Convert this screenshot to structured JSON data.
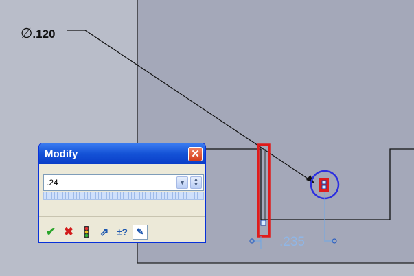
{
  "drawing": {
    "diameter_symbol": "∅",
    "diameter_value": ".120",
    "linear_dimension": ".235",
    "colors": {
      "sheet_bg": "#b9bdc9",
      "part_bg": "#a4a8b9",
      "highlight": "#e01b1b",
      "selection_circle": "#2b2ee0",
      "dimension_blue": "#8fb6e6"
    }
  },
  "modify_dialog": {
    "title": "Modify",
    "close_icon": "close-icon",
    "value": ".24",
    "toolbar": [
      {
        "name": "ok-button",
        "icon": "checkmark-icon",
        "glyph": "✔"
      },
      {
        "name": "cancel-button",
        "icon": "x-icon",
        "glyph": "✖"
      },
      {
        "name": "rebuild-button",
        "icon": "traffic-light-icon",
        "glyph": "🚦"
      },
      {
        "name": "reverse-button",
        "icon": "reverse-direction-icon",
        "glyph": "⇗"
      },
      {
        "name": "mark-button",
        "icon": "mark-dimension-icon",
        "glyph": "±?"
      },
      {
        "name": "measure-button",
        "icon": "measure-icon",
        "glyph": "✎"
      }
    ]
  }
}
